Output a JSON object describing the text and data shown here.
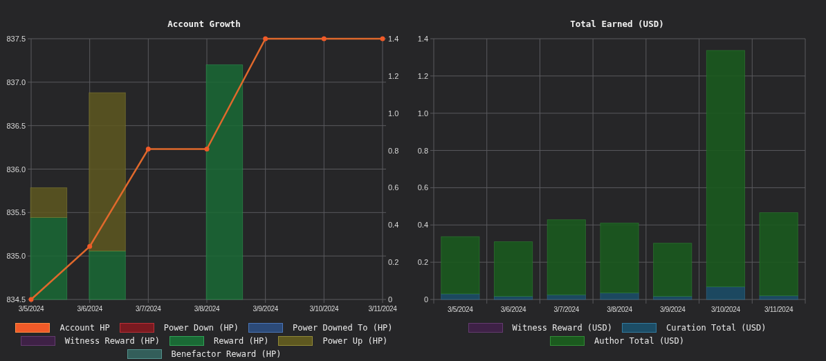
{
  "charts": [
    {
      "chart_data": {
        "type": "bar",
        "title": "Account Growth",
        "x": [
          "3/5/2024",
          "3/6/2024",
          "3/7/2024",
          "3/8/2024",
          "3/9/2024",
          "3/10/2024",
          "3/11/2024"
        ],
        "stacked": true,
        "grid": true,
        "ylim": [
          0,
          1.4
        ],
        "yticks": [
          {
            "value": 0,
            "label": "0"
          },
          {
            "value": 0.2,
            "label": "0.2"
          },
          {
            "value": 0.4,
            "label": "0.4"
          },
          {
            "value": 0.6,
            "label": "0.6"
          },
          {
            "value": 0.8,
            "label": "0.8"
          },
          {
            "value": 1,
            "label": "1.0"
          },
          {
            "value": 1.2,
            "label": "1.2"
          },
          {
            "value": 1.4,
            "label": "1.4"
          }
        ],
        "y2lim": [
          834.5,
          837.5
        ],
        "y2ticks": [
          {
            "value": 834.5,
            "label": "834.5"
          },
          {
            "value": 835,
            "label": "835.0"
          },
          {
            "value": 835.5,
            "label": "835.5"
          },
          {
            "value": 836,
            "label": "836.0"
          },
          {
            "value": 836.5,
            "label": "836.5"
          },
          {
            "value": 837,
            "label": "837.0"
          },
          {
            "value": 837.5,
            "label": "837.5"
          }
        ],
        "series": [
          {
            "name": "Account HP",
            "type": "line",
            "axis": "y2",
            "marker": true,
            "color": "#f05a28",
            "values": [
              834.5,
              835.11,
              836.23,
              836.23,
              837.5,
              837.5,
              837.5
            ]
          },
          {
            "name": "Power Down (HP)",
            "type": "bar",
            "axis": "y",
            "color": "#7a1a20",
            "values": [
              null,
              null,
              null,
              null,
              null,
              null,
              null
            ]
          },
          {
            "name": "Power Downed To (HP)",
            "type": "bar",
            "axis": "y",
            "color": "#2c4a78",
            "values": [
              null,
              null,
              null,
              null,
              null,
              null,
              null
            ]
          },
          {
            "name": "Witness Reward (HP)",
            "type": "bar",
            "axis": "y",
            "color": "#3e2146",
            "values": [
              null,
              null,
              null,
              null,
              null,
              null,
              null
            ]
          },
          {
            "name": "Reward (HP)",
            "type": "bar",
            "axis": "y",
            "color": "#1a6a35",
            "values": [
              0.44,
              0.26,
              null,
              1.26,
              null,
              null,
              null
            ]
          },
          {
            "name": "Power Up (HP)",
            "type": "bar",
            "axis": "y",
            "color": "#5e5820",
            "values": [
              0.16,
              0.85,
              null,
              null,
              null,
              null,
              null
            ]
          },
          {
            "name": "Benefactor Reward (HP)",
            "type": "bar",
            "axis": "y",
            "color": "#335e5a",
            "values": [
              null,
              null,
              null,
              null,
              null,
              null,
              null
            ]
          }
        ]
      }
    },
    {
      "chart_data": {
        "type": "bar",
        "title": "Total Earned (USD)",
        "categories": [
          "3/5/2024",
          "3/6/2024",
          "3/7/2024",
          "3/8/2024",
          "3/9/2024",
          "3/10/2024",
          "3/11/2024"
        ],
        "stacked": true,
        "grid": true,
        "ylim": [
          0,
          1.4
        ],
        "yticks": [
          {
            "value": 0,
            "label": "0"
          },
          {
            "value": 0.2,
            "label": "0.2"
          },
          {
            "value": 0.4,
            "label": "0.4"
          },
          {
            "value": 0.6,
            "label": "0.6"
          },
          {
            "value": 0.8,
            "label": "0.8"
          },
          {
            "value": 1,
            "label": "1.0"
          },
          {
            "value": 1.2,
            "label": "1.2"
          },
          {
            "value": 1.4,
            "label": "1.4"
          }
        ],
        "series": [
          {
            "name": "Witness Reward (USD)",
            "type": "bar",
            "color": "#3e2146",
            "values": [
              0,
              0,
              0,
              0,
              0,
              0,
              0
            ]
          },
          {
            "name": "Curation Total (USD)",
            "type": "bar",
            "color": "#1c4d66",
            "values": [
              0.03,
              0.017,
              0.025,
              0.035,
              0.017,
              0.068,
              0.02
            ]
          },
          {
            "name": "Author Total (USD)",
            "type": "bar",
            "color": "#1b5a1e",
            "values": [
              0.307,
              0.293,
              0.403,
              0.375,
              0.285,
              1.269,
              0.446
            ]
          }
        ]
      }
    }
  ]
}
